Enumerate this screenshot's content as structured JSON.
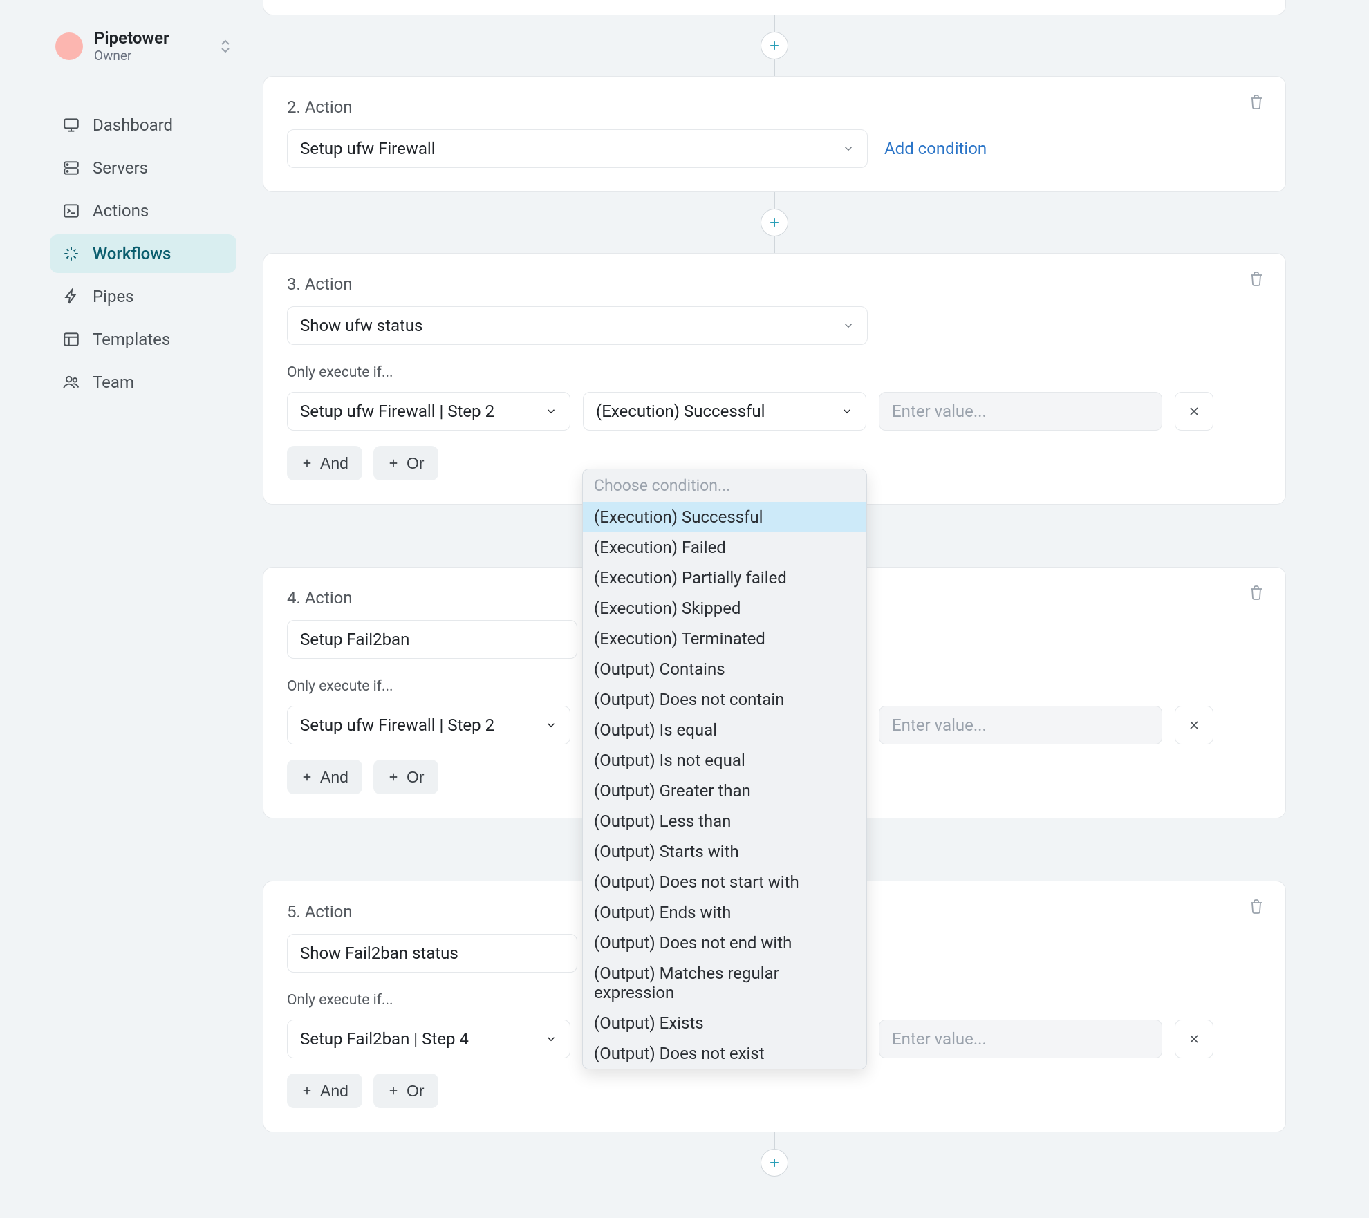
{
  "org": {
    "name": "Pipetower",
    "role": "Owner"
  },
  "nav": {
    "items": [
      {
        "label": "Dashboard",
        "icon": "monitor"
      },
      {
        "label": "Servers",
        "icon": "server"
      },
      {
        "label": "Actions",
        "icon": "terminal"
      },
      {
        "label": "Workflows",
        "icon": "sparkle",
        "active": true
      },
      {
        "label": "Pipes",
        "icon": "bolt"
      },
      {
        "label": "Templates",
        "icon": "layout"
      },
      {
        "label": "Team",
        "icon": "users"
      }
    ]
  },
  "common": {
    "condition_prefix": "Only execute if...",
    "add_condition": "Add condition",
    "value_placeholder": "Enter value...",
    "and": "And",
    "or": "Or"
  },
  "dropdown": {
    "placeholder": "Choose condition...",
    "items": [
      "(Execution) Successful",
      "(Execution) Failed",
      "(Execution) Partially failed",
      "(Execution) Skipped",
      "(Execution) Terminated",
      "(Output) Contains",
      "(Output) Does not contain",
      "(Output) Is equal",
      "(Output) Is not equal",
      "(Output) Greater than",
      "(Output) Less than",
      "(Output) Starts with",
      "(Output) Does not start with",
      "(Output) Ends with",
      "(Output) Does not end with",
      "(Output) Matches regular expression",
      "(Output) Exists",
      "(Output) Does not exist"
    ],
    "highlight_index": 0
  },
  "steps": [
    {
      "title": "2. Action",
      "action": "Setup ufw Firewall",
      "has_condition": false
    },
    {
      "title": "3. Action",
      "action": "Show ufw status",
      "has_condition": true,
      "cond_step": "Setup ufw Firewall | Step 2",
      "cond_cond": "(Execution) Successful"
    },
    {
      "title": "4. Action",
      "action": "Setup Fail2ban",
      "has_condition": true,
      "cond_step": "Setup ufw Firewall | Step 2",
      "cond_cond": ""
    },
    {
      "title": "5. Action",
      "action": "Show Fail2ban status",
      "has_condition": true,
      "cond_step": "Setup Fail2ban | Step 4",
      "cond_cond": "(Execution) Successful",
      "cond_active": true
    }
  ]
}
